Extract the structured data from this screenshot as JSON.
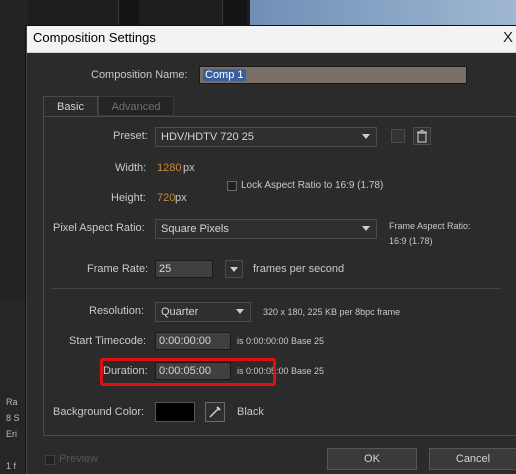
{
  "background": {
    "cells": [
      "Ra",
      "8 S",
      "Eri",
      "1 f"
    ]
  },
  "dialog": {
    "title": "Composition Settings",
    "close_glyph": "X",
    "comp_name_label": "Composition Name:",
    "comp_name_value": "Comp 1",
    "tabs": [
      "Basic",
      "Advanced"
    ],
    "preset_label": "Preset:",
    "preset_value": "HDV/HDTV 720 25",
    "width_label": "Width:",
    "width_value": "1280",
    "height_label": "Height:",
    "height_value": "720",
    "px_unit": "px",
    "lock_label": "Lock Aspect Ratio to 16:9 (1.78)",
    "par_label": "Pixel Aspect Ratio:",
    "par_value": "Square Pixels",
    "frame_aspect_line1": "Frame Aspect Ratio:",
    "frame_aspect_line2": "16:9 (1.78)",
    "frame_rate_label": "Frame Rate:",
    "frame_rate_value": "25",
    "fps_label": "frames per second",
    "resolution_label": "Resolution:",
    "resolution_value": "Quarter",
    "resolution_info": "320 x 180, 225 KB per 8bpc frame",
    "start_tc_label": "Start Timecode:",
    "start_tc_value": "0:00:00:00",
    "start_tc_info": "is 0:00:00:00  Base 25",
    "duration_label": "Duration:",
    "duration_value": "0:00:05:00",
    "duration_info": "is 0:00:05:00  Base 25",
    "bg_color_label": "Background Color:",
    "bg_color_name": "Black",
    "preview_label": "Preview",
    "ok_label": "OK",
    "cancel_label": "Cancel"
  },
  "colors": {
    "accent_orange": "#c8873a",
    "highlight_red": "#e00f12",
    "background_color": "#000000"
  },
  "icons": [
    "close-icon",
    "dropdown-arrow-icon",
    "save-preset-icon",
    "trash-icon",
    "eyedropper-icon",
    "checkbox-icon"
  ]
}
